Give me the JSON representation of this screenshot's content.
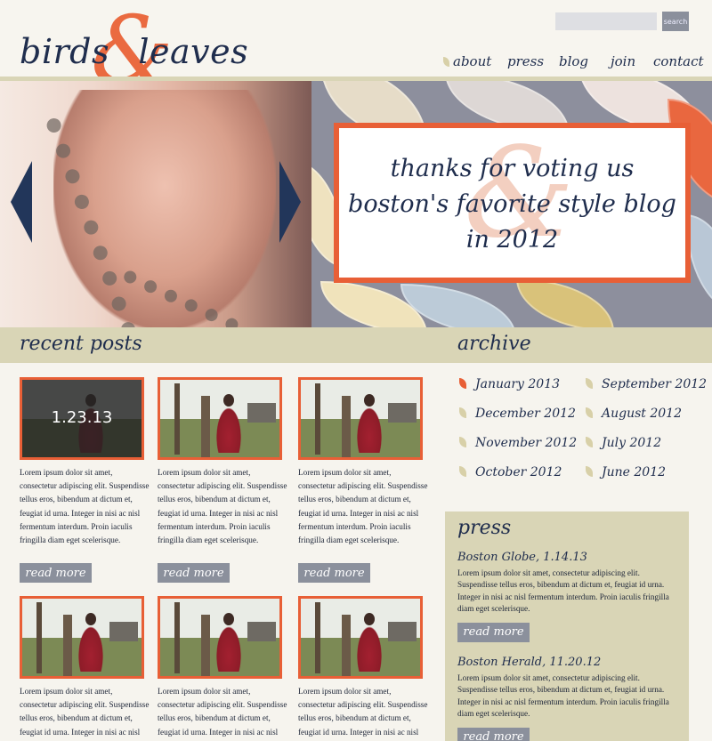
{
  "header": {
    "logo": {
      "word_left": "birds",
      "ampersand": "&",
      "word_right": "leaves"
    },
    "search": {
      "placeholder": "",
      "button_label": "search"
    },
    "nav": [
      {
        "label": "about"
      },
      {
        "label": "press"
      },
      {
        "label": "blog"
      },
      {
        "label": "join"
      },
      {
        "label": "contact"
      }
    ]
  },
  "hero": {
    "promo_lines": [
      "thanks for voting us",
      "boston's favorite style blog",
      "in 2012"
    ],
    "promo_ampersand": "&"
  },
  "recent_posts": {
    "heading": "recent posts",
    "excerpt": "Lorem ipsum dolor sit amet, consectetur adipiscing elit. Suspendisse tellus eros, bibendum at dictum et, feugiat id urna. Integer in nisi ac nisl fermentum interdum. Proin iaculis fringilla diam eget scelerisque.",
    "read_more_label": "read more",
    "posts": [
      {
        "date_overlay": "1.23.13"
      },
      {
        "date_overlay": ""
      },
      {
        "date_overlay": ""
      },
      {
        "date_overlay": ""
      },
      {
        "date_overlay": ""
      },
      {
        "date_overlay": ""
      }
    ]
  },
  "archive": {
    "heading": "archive",
    "items": [
      {
        "label": "January 2013",
        "active": true
      },
      {
        "label": "December 2012",
        "active": false
      },
      {
        "label": "November 2012",
        "active": false
      },
      {
        "label": "October 2012",
        "active": false
      },
      {
        "label": "September 2012",
        "active": false
      },
      {
        "label": "August 2012",
        "active": false
      },
      {
        "label": "July 2012",
        "active": false
      },
      {
        "label": "June 2012",
        "active": false
      }
    ]
  },
  "press": {
    "heading": "press",
    "read_more_label": "read more",
    "items": [
      {
        "title": "Boston Globe, 1.14.13",
        "body": "Lorem ipsum dolor sit amet, consectetur adipiscing elit. Suspendisse tellus eros, bibendum at dictum et, feugiat id urna. Integer in nisi ac nisl fermentum interdum. Proin iaculis fringilla diam eget scelerisque."
      },
      {
        "title": "Boston Herald, 11.20.12",
        "body": "Lorem ipsum dolor sit amet, consectetur adipiscing elit. Suspendisse tellus eros, bibendum at dictum et, feugiat id urna. Integer in nisi ac nisl fermentum interdum. Proin iaculis fringilla diam eget scelerisque."
      }
    ]
  },
  "colors": {
    "navy": "#1f2d4d",
    "accent_orange": "#e85f36",
    "sand": "#d9d5b6",
    "button_gray": "#8b909c"
  },
  "icons": [
    "leaf-bullet-icon",
    "arrow-left-icon",
    "arrow-right-icon"
  ]
}
